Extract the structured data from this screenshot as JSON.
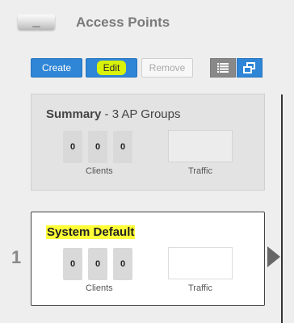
{
  "header": {
    "title": "Access Points",
    "device_icon": "access-point-icon"
  },
  "toolbar": {
    "create_label": "Create",
    "edit_label": "Edit",
    "remove_label": "Remove",
    "list_view_icon": "list-icon",
    "grid_view_icon": "tiles-icon"
  },
  "summary": {
    "title_bold": "Summary",
    "title_rest": " - 3 AP Groups",
    "counts": [
      "0",
      "0",
      "0"
    ],
    "clients_label": "Clients",
    "traffic_label": "Traffic"
  },
  "groups": [
    {
      "index": "1",
      "name": "System Default",
      "counts": [
        "0",
        "0",
        "0"
      ],
      "clients_label": "Clients",
      "traffic_label": "Traffic"
    }
  ],
  "colors": {
    "accent": "#2f86d6",
    "highlight_edit": "#d8f20a",
    "highlight_title": "#ffff37"
  }
}
